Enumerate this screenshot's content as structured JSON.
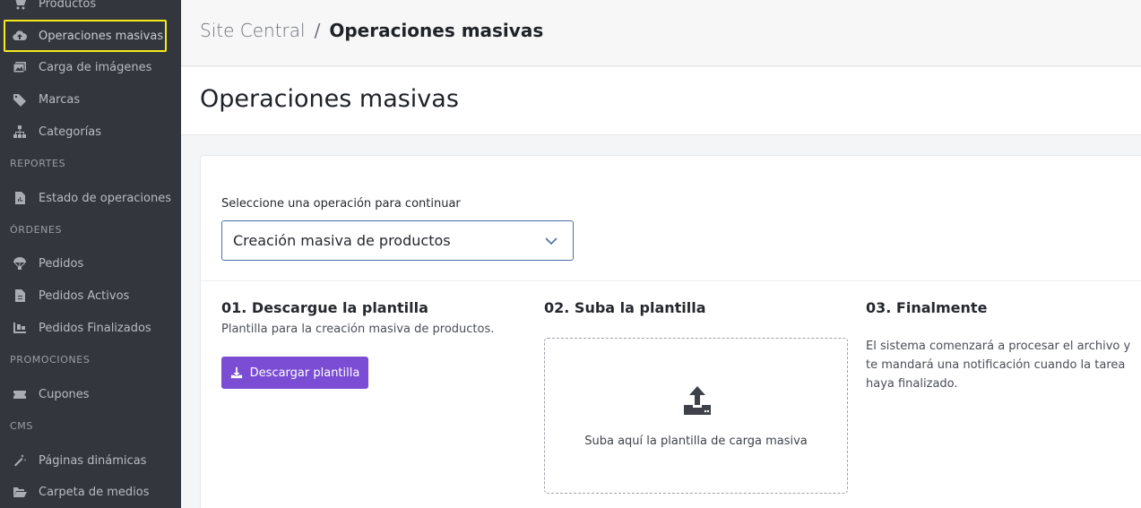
{
  "sidebar": {
    "items": [
      {
        "label": "Productos",
        "icon": "cart-icon"
      },
      {
        "label": "Operaciones masivas",
        "icon": "cloud-upload-icon"
      },
      {
        "label": "Carga de imágenes",
        "icon": "images-icon"
      },
      {
        "label": "Marcas",
        "icon": "tags-icon"
      },
      {
        "label": "Categorías",
        "icon": "sitemap-icon"
      },
      {
        "label": "Estado de operaciones",
        "icon": "file-report-icon"
      },
      {
        "label": "Pedidos",
        "icon": "parachute-icon"
      },
      {
        "label": "Pedidos Activos",
        "icon": "file-icon"
      },
      {
        "label": "Pedidos Finalizados",
        "icon": "dolly-icon"
      },
      {
        "label": "Cupones",
        "icon": "ticket-icon"
      },
      {
        "label": "Páginas dinámicas",
        "icon": "magic-wand-icon"
      },
      {
        "label": "Carpeta de medios",
        "icon": "folder-open-icon"
      }
    ],
    "sections": [
      "REPORTES",
      "ÓRDENES",
      "PROMOCIONES",
      "CMS"
    ],
    "highlight_color": "#f5ea1e"
  },
  "breadcrumb": {
    "root": "Site Central",
    "separator": "/",
    "current": "Operaciones masivas"
  },
  "page_title": "Operaciones masivas",
  "form": {
    "select_label": "Seleccione una operación para continuar",
    "select_value": "Creación masiva de productos"
  },
  "steps": {
    "step1": {
      "title": "01. Descargue la plantilla",
      "desc": "Plantilla para la creación masiva de productos.",
      "button": "Descargar plantilla"
    },
    "step2": {
      "title": "02. Suba la plantilla",
      "dropzone_text": "Suba aquí la plantilla de carga masiva"
    },
    "step3": {
      "title": "03. Finalmente",
      "desc": "El sistema comenzará a procesar el archivo y te mandará una notificación cuando la tarea haya finalizado."
    }
  },
  "colors": {
    "sidebar_bg": "#33373d",
    "accent_button": "#7b4dd4",
    "select_border": "#4a6fa8"
  }
}
